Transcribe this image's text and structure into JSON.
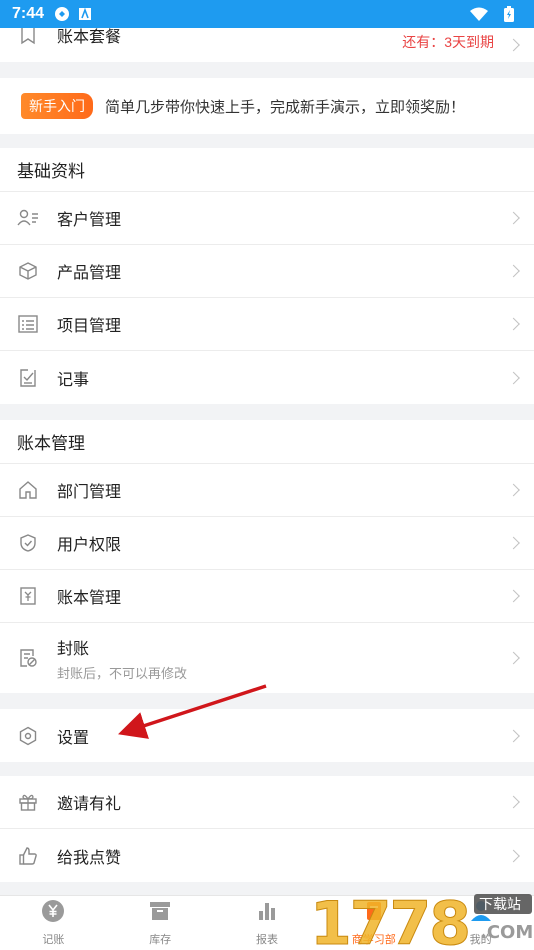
{
  "status": {
    "time": "7:44"
  },
  "top_item": {
    "label": "账本套餐",
    "expire_text": "还有：3天到期"
  },
  "banner": {
    "badge": "新手入门",
    "text": "简单几步带你快速上手，完成新手演示，立即领奖励！"
  },
  "basic": {
    "title": "基础资料",
    "items": [
      {
        "label": "客户管理",
        "icon": "customer-icon"
      },
      {
        "label": "产品管理",
        "icon": "product-icon"
      },
      {
        "label": "项目管理",
        "icon": "project-icon"
      },
      {
        "label": "记事",
        "icon": "note-icon"
      }
    ]
  },
  "account": {
    "title": "账本管理",
    "items": [
      {
        "label": "部门管理",
        "icon": "home-icon"
      },
      {
        "label": "用户权限",
        "icon": "shield-icon"
      },
      {
        "label": "账本管理",
        "icon": "ledger-icon"
      },
      {
        "label": "封账",
        "sub": "封账后，不可以再修改",
        "icon": "seal-icon"
      }
    ]
  },
  "settings": {
    "label": "设置",
    "icon": "settings-icon"
  },
  "extra": {
    "items": [
      {
        "label": "邀请有礼",
        "icon": "gift-icon"
      },
      {
        "label": "给我点赞",
        "icon": "thumbs-up-icon"
      }
    ]
  },
  "tabs": [
    {
      "label": "记账",
      "icon": "yuan-icon"
    },
    {
      "label": "库存",
      "icon": "inventory-icon"
    },
    {
      "label": "报表",
      "icon": "report-icon"
    },
    {
      "label": "商学习部",
      "icon": "learn-icon"
    },
    {
      "label": "我的",
      "icon": "me-icon"
    }
  ],
  "watermark": {
    "text": "1778",
    "site": "下载站",
    "domain": ".COM"
  },
  "colors": {
    "status_bar": "#1e9bf0",
    "accent": "#ff6a1a",
    "expire": "#e94444",
    "arrow": "#d0161b"
  }
}
